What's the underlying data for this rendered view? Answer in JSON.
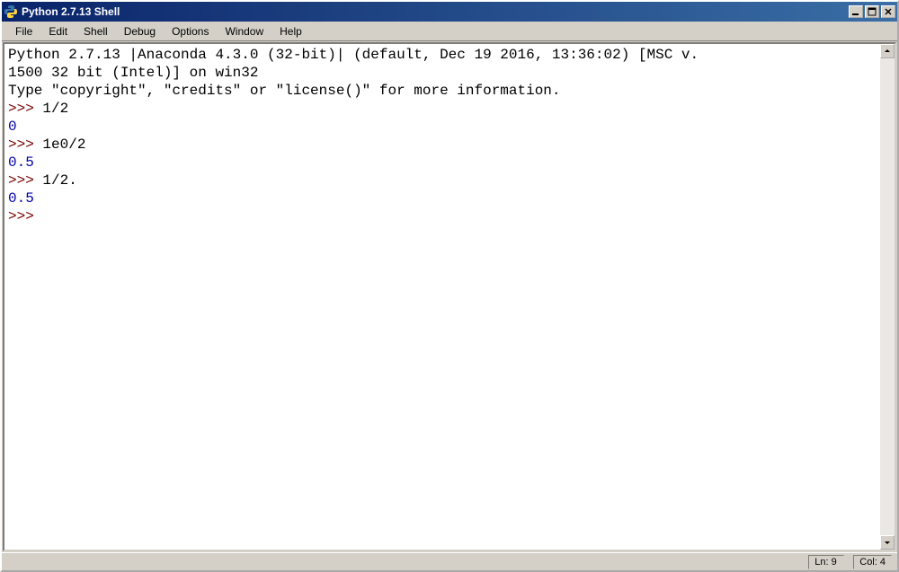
{
  "window": {
    "title": "Python 2.7.13 Shell"
  },
  "menu": {
    "file": "File",
    "edit": "Edit",
    "shell": "Shell",
    "debug": "Debug",
    "options": "Options",
    "window": "Window",
    "help": "Help"
  },
  "shell": {
    "banner1": "Python 2.7.13 |Anaconda 4.3.0 (32-bit)| (default, Dec 19 2016, 13:36:02) [MSC v.",
    "banner2": "1500 32 bit (Intel)] on win32",
    "banner3": "Type \"copyright\", \"credits\" or \"license()\" for more information.",
    "prompt": ">>> ",
    "in1": "1/2",
    "out1": "0",
    "in2": "1e0/2",
    "out2": "0.5",
    "in3": "1/2.",
    "out3": "0.5"
  },
  "status": {
    "ln": "Ln: 9",
    "col": "Col: 4"
  }
}
